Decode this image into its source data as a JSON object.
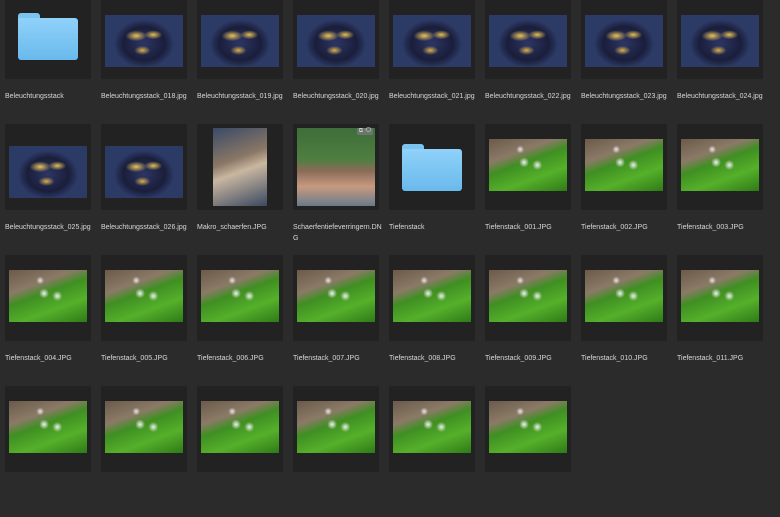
{
  "items": [
    {
      "name": "Beleuchtungsstack",
      "kind": "folder"
    },
    {
      "name": "Beleuchtungsstack_018.jpg",
      "kind": "mush"
    },
    {
      "name": "Beleuchtungsstack_019.jpg",
      "kind": "mush"
    },
    {
      "name": "Beleuchtungsstack_020.jpg",
      "kind": "mush"
    },
    {
      "name": "Beleuchtungsstack_021.jpg",
      "kind": "mush"
    },
    {
      "name": "Beleuchtungsstack_022.jpg",
      "kind": "mush"
    },
    {
      "name": "Beleuchtungsstack_023.jpg",
      "kind": "mush"
    },
    {
      "name": "Beleuchtungsstack_024.jpg",
      "kind": "mush"
    },
    {
      "name": "Beleuchtungsstack_025.jpg",
      "kind": "mush"
    },
    {
      "name": "Beleuchtungsstack_026.jpg",
      "kind": "mush"
    },
    {
      "name": "Makro_schaerfen.JPG",
      "kind": "grass"
    },
    {
      "name": "Schaerfentiefeverringern.DNG",
      "kind": "city"
    },
    {
      "name": "Tiefenstack",
      "kind": "folder"
    },
    {
      "name": "Tiefenstack_001.JPG",
      "kind": "moss"
    },
    {
      "name": "Tiefenstack_002.JPG",
      "kind": "moss"
    },
    {
      "name": "Tiefenstack_003.JPG",
      "kind": "moss"
    },
    {
      "name": "Tiefenstack_004.JPG",
      "kind": "moss"
    },
    {
      "name": "Tiefenstack_005.JPG",
      "kind": "moss"
    },
    {
      "name": "Tiefenstack_006.JPG",
      "kind": "moss"
    },
    {
      "name": "Tiefenstack_007.JPG",
      "kind": "moss"
    },
    {
      "name": "Tiefenstack_008.JPG",
      "kind": "moss"
    },
    {
      "name": "Tiefenstack_009.JPG",
      "kind": "moss"
    },
    {
      "name": "Tiefenstack_010.JPG",
      "kind": "moss"
    },
    {
      "name": "Tiefenstack_011.JPG",
      "kind": "moss"
    },
    {
      "name": "",
      "kind": "moss"
    },
    {
      "name": "",
      "kind": "moss"
    },
    {
      "name": "",
      "kind": "moss"
    },
    {
      "name": "",
      "kind": "moss"
    },
    {
      "name": "",
      "kind": "moss"
    },
    {
      "name": "",
      "kind": "moss"
    }
  ],
  "badge": "⧉ ⟲"
}
